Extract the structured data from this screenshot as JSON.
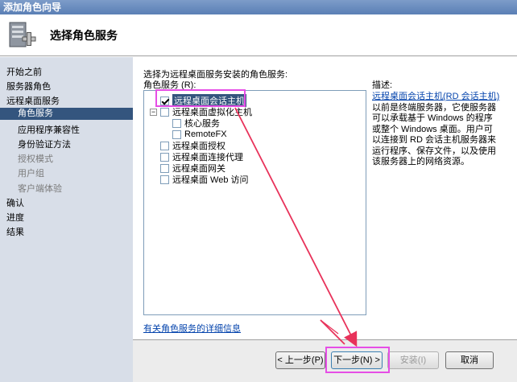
{
  "window": {
    "title": "添加角色向导"
  },
  "header": {
    "title": "选择角色服务"
  },
  "sidebar": {
    "items": [
      {
        "label": "开始之前",
        "level": 0,
        "state": "normal"
      },
      {
        "label": "服务器角色",
        "level": 0,
        "state": "normal"
      },
      {
        "label": "远程桌面服务",
        "level": 0,
        "state": "normal"
      },
      {
        "label": "角色服务",
        "level": 1,
        "state": "active"
      },
      {
        "label": "应用程序兼容性",
        "level": 1,
        "state": "normal"
      },
      {
        "label": "身份验证方法",
        "level": 1,
        "state": "normal"
      },
      {
        "label": "授权模式",
        "level": 1,
        "state": "disabled"
      },
      {
        "label": "用户组",
        "level": 1,
        "state": "disabled"
      },
      {
        "label": "客户端体验",
        "level": 1,
        "state": "disabled"
      },
      {
        "label": "确认",
        "level": 0,
        "state": "normal"
      },
      {
        "label": "进度",
        "level": 0,
        "state": "normal"
      },
      {
        "label": "结果",
        "level": 0,
        "state": "normal"
      }
    ]
  },
  "main": {
    "instruction": "选择为远程桌面服务安装的角色服务:",
    "roles_label": "角色服务 (R):",
    "description_label": "描述:",
    "role_services": [
      {
        "label": "远程桌面会话主机",
        "checked": true,
        "selected": true
      },
      {
        "label": "远程桌面虚拟化主机",
        "checked": false,
        "expandable": true
      },
      {
        "label": "核心服务",
        "checked": false,
        "child": true
      },
      {
        "label": "RemoteFX",
        "checked": false,
        "child": true
      },
      {
        "label": "远程桌面授权",
        "checked": false
      },
      {
        "label": "远程桌面连接代理",
        "checked": false
      },
      {
        "label": "远程桌面网关",
        "checked": false
      },
      {
        "label": "远程桌面 Web 访问",
        "checked": false
      }
    ],
    "description": {
      "link": "远程桌面会话主机(RD 会话主机)",
      "text": "以前是终端服务器，它使服务器可以承载基于 Windows 的程序或整个 Windows 桌面。用户可以连接到 RD 会话主机服务器来运行程序、保存文件，以及使用该服务器上的网络资源。"
    },
    "more_info_link": "有关角色服务的详细信息"
  },
  "buttons": {
    "back": "< 上一步(P)",
    "next": "下一步(N) >",
    "install": "安装(I)",
    "cancel": "取消"
  },
  "colors": {
    "accent": "#34557e",
    "annotation": "#e64ee6",
    "arrow": "#e8325a"
  }
}
